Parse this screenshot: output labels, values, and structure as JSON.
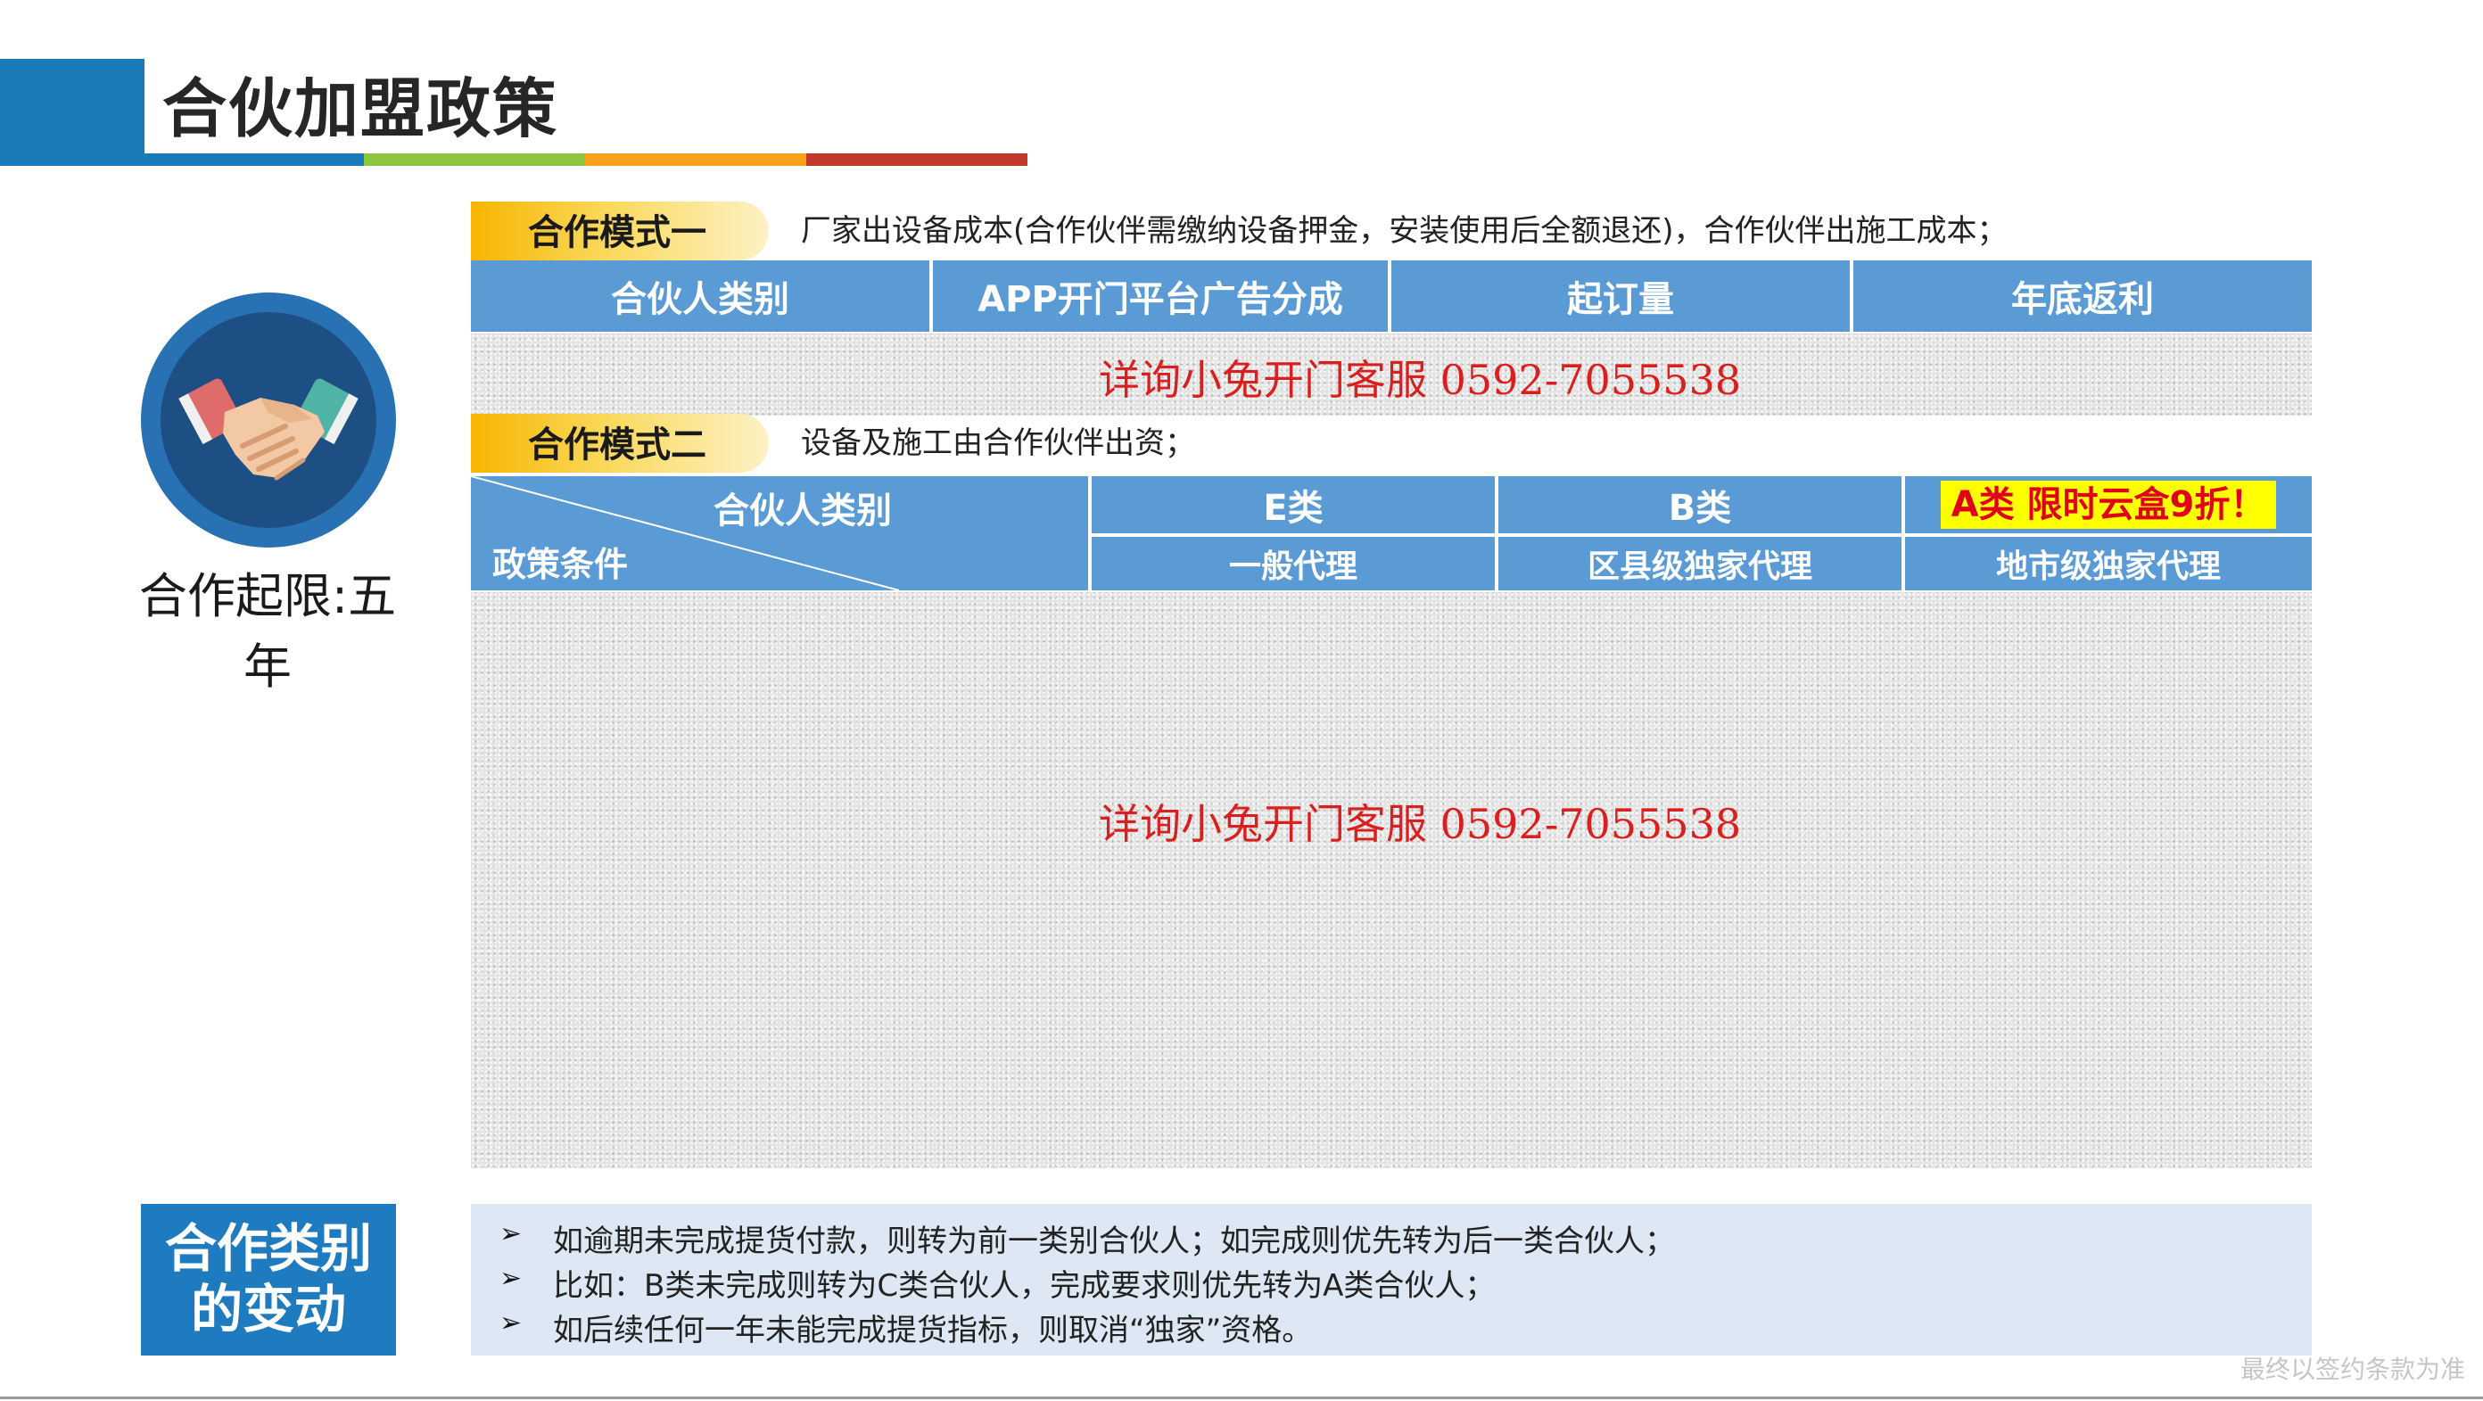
{
  "header": {
    "title": "合伙加盟政策"
  },
  "left_panel": {
    "icon": "handshake-icon",
    "caption": "合作起限:五年"
  },
  "mode1": {
    "label": "合作模式一",
    "description": "厂家出设备成本(合作伙伴需缴纳设备押金，安装使用后全额退还)，合作伙伴出施工成本；",
    "columns": [
      "合伙人类别",
      "APP开门平台广告分成",
      "起订量",
      "年底返利"
    ],
    "contact": "详询小兔开门客服 0592-7055538"
  },
  "mode2": {
    "label": "合作模式二",
    "description": "设备及施工由合作伙伴出资；",
    "corner_top": "合伙人类别",
    "corner_bottom": "政策条件",
    "categories": [
      {
        "class": "E类",
        "type": "一般代理"
      },
      {
        "class": "B类",
        "type": "区县级独家代理"
      },
      {
        "class": "A类  限时云盒9折！",
        "type": "地市级独家代理"
      }
    ],
    "contact": "详询小兔开门客服 0592-7055538"
  },
  "change": {
    "title_line1": "合作类别",
    "title_line2": "的变动",
    "bullet_glyph": "➢",
    "notes": [
      "如逾期未完成提货付款，则转为前一类别合伙人；如完成则优先转为后一类合伙人；",
      "比如：B类未完成则转为C类合伙人，完成要求则优先转为A类合伙人；",
      "如后续任何一年未能完成提货指标，则取消“独家”资格。"
    ]
  },
  "footer": {
    "disclaimer": "最终以签约条款为准"
  },
  "colors": {
    "brand_blue": "#1b7ab8",
    "table_blue": "#5b9bd5",
    "accent_green": "#8cc63f",
    "accent_orange": "#f9a11b",
    "accent_red": "#c0392b",
    "label_gold": "#f7b500",
    "contact_red": "#d9201e",
    "highlight_yellow": "#ffff00"
  }
}
